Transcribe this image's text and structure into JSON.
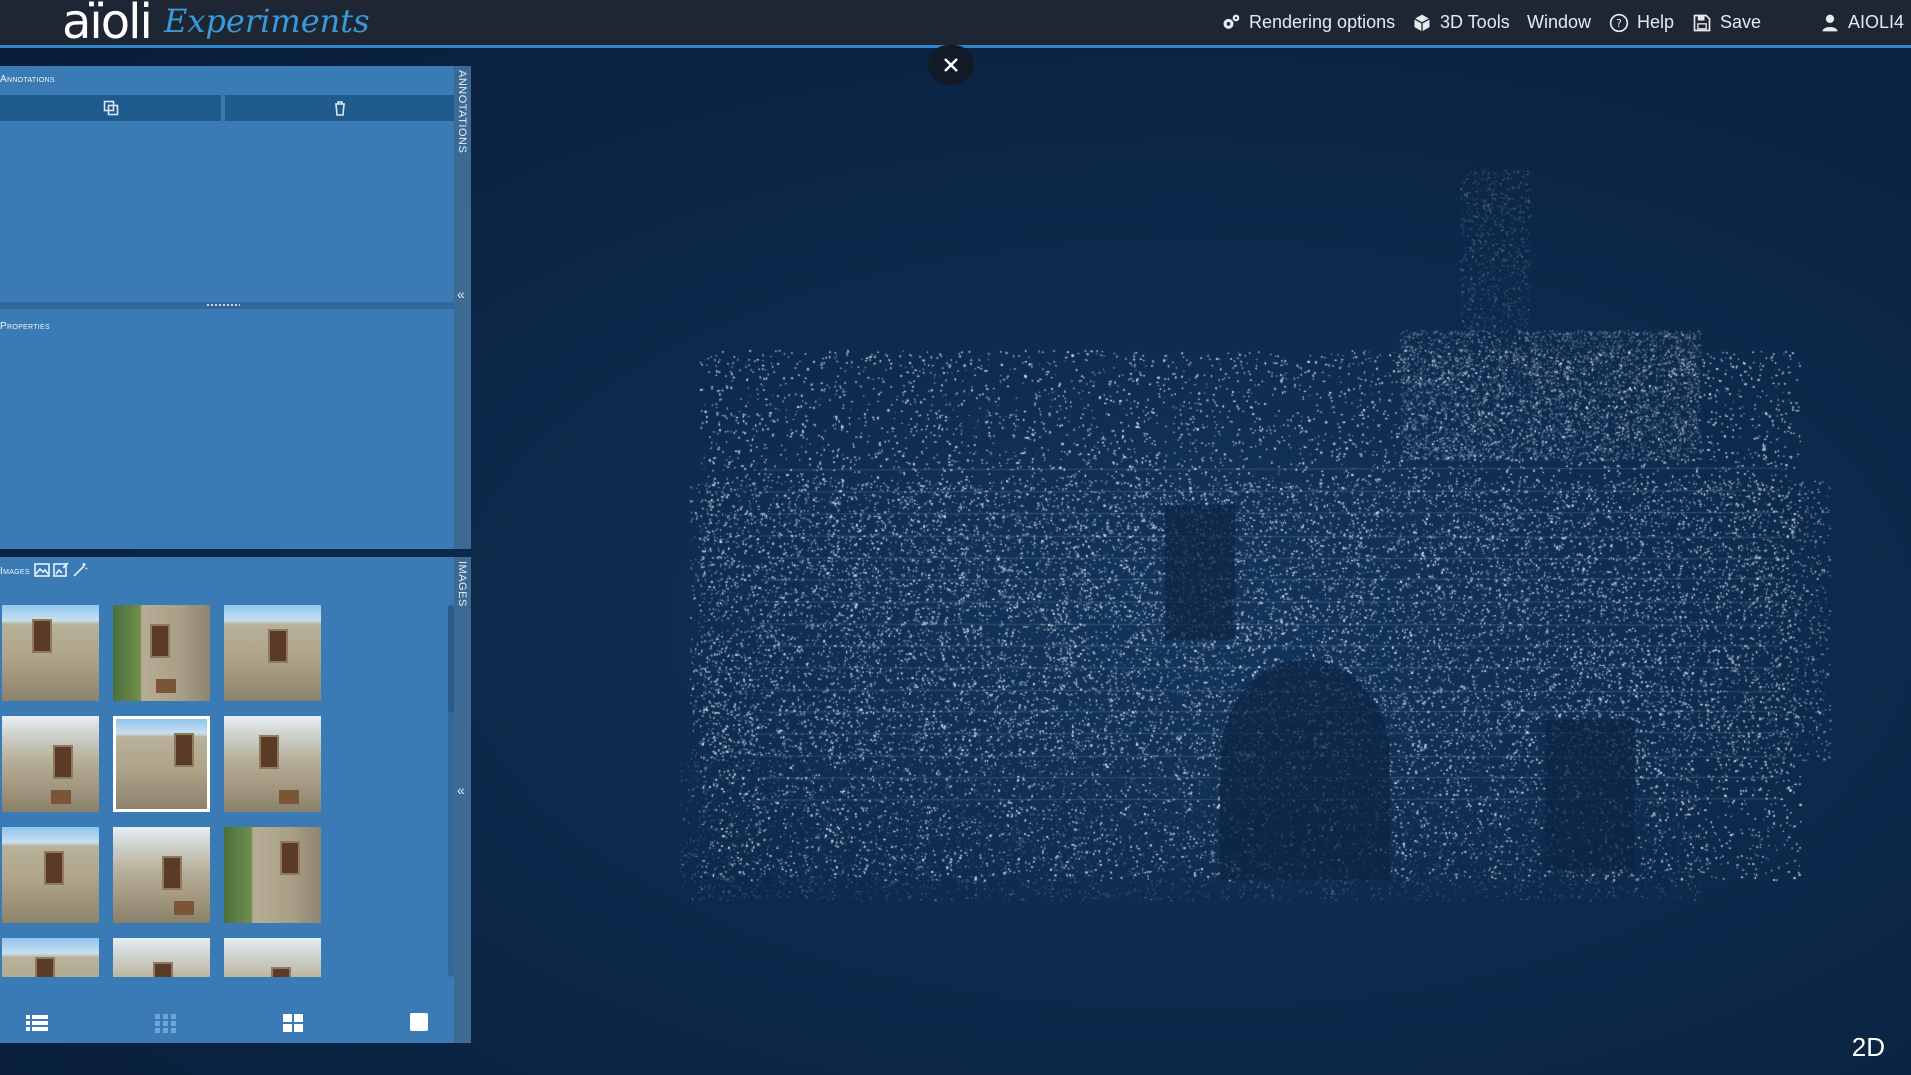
{
  "header": {
    "logo": "aïoli",
    "logo_sub": "Experiments",
    "menu": {
      "rendering_options": "Rendering options",
      "tools_3d": "3D Tools",
      "window": "Window",
      "help": "Help",
      "save": "Save",
      "user": "AIOLI4"
    }
  },
  "annotations_panel": {
    "title": "Annotations",
    "side_label": "ANNOTATIONS",
    "buttons": [
      "duplicate-icon",
      "trash-icon"
    ],
    "properties_title": "Properties"
  },
  "images_panel": {
    "title": "Images",
    "side_label": "IMAGES",
    "header_icons": [
      "image-icon",
      "image-edit-icon",
      "magic-wand-icon"
    ],
    "thumbnails": [
      {
        "variant": "sky",
        "selected": false
      },
      {
        "variant": "tree",
        "selected": false
      },
      {
        "variant": "sky",
        "selected": false
      },
      {
        "variant": "plain",
        "selected": false
      },
      {
        "variant": "sky",
        "selected": true
      },
      {
        "variant": "plain",
        "selected": false
      },
      {
        "variant": "sky",
        "selected": false
      },
      {
        "variant": "plain",
        "selected": false
      },
      {
        "variant": "tree",
        "selected": false
      },
      {
        "variant": "sky",
        "selected": false
      },
      {
        "variant": "plain",
        "selected": false
      },
      {
        "variant": "plain",
        "selected": false
      }
    ],
    "view_modes": [
      "list-view-icon",
      "small-grid-icon",
      "large-grid-icon",
      "single-view-icon"
    ]
  },
  "viewer": {
    "close_icon": "close-icon",
    "mode": "2D"
  },
  "colors": {
    "topbar": "#1e2633",
    "accent": "#2f86c8",
    "panel": "#3a7bb5",
    "button": "#1f5a8d",
    "background": "#0d2a4c"
  }
}
